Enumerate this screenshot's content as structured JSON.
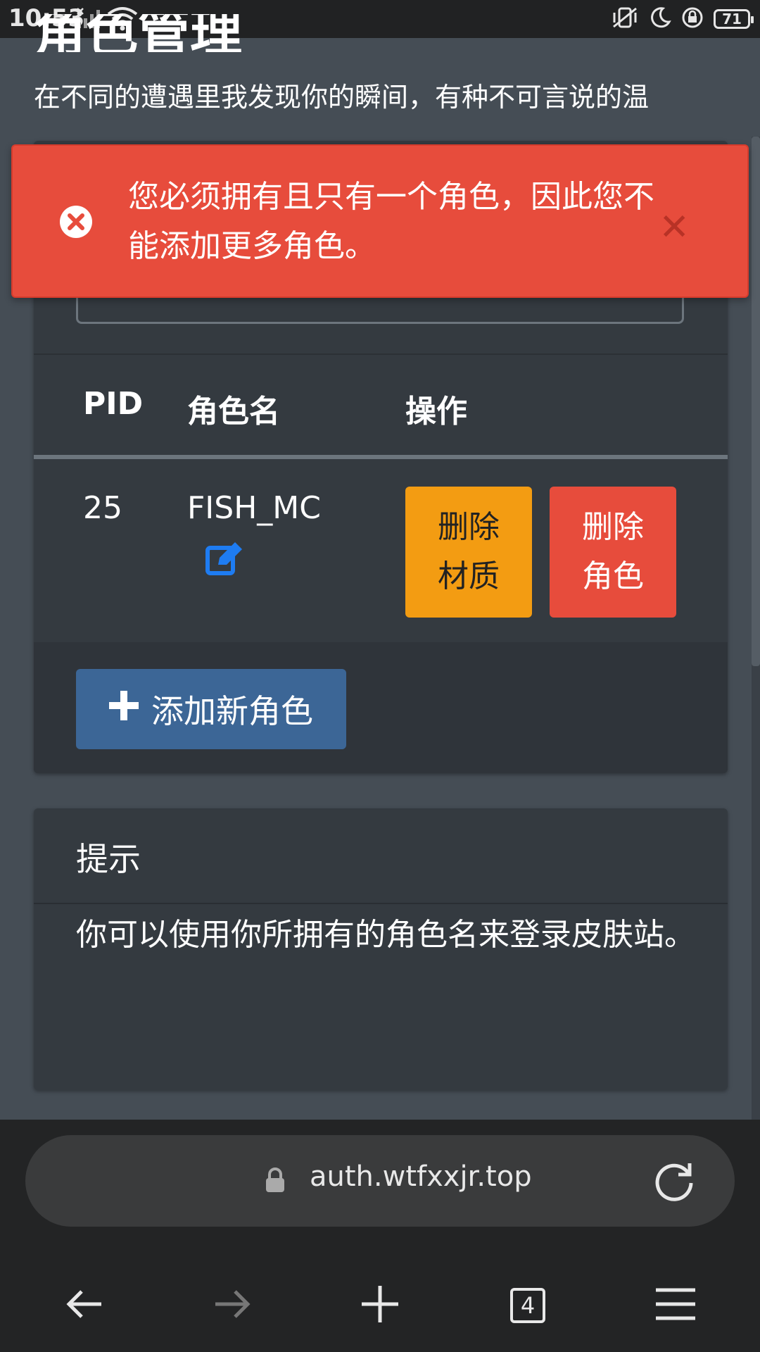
{
  "status_bar": {
    "time": "10:53",
    "battery": "71"
  },
  "page": {
    "title": "角色管理",
    "subtitle": "在不同的遭遇里我发现你的瞬间，有种不可言说的温"
  },
  "alert": {
    "message": "您必须拥有且只有一个角色，因此您不能添加更多角色。",
    "icon": "error-circle-icon",
    "close_icon": "close-icon"
  },
  "players_table": {
    "columns": [
      "PID",
      "角色名",
      "操作"
    ],
    "rows": [
      {
        "pid": "25",
        "name": "FISH_MC",
        "actions": {
          "delete_texture": "删除材质",
          "delete_player": "删除角色"
        }
      }
    ],
    "add_button": "添加新角色"
  },
  "tips": {
    "title": "提示",
    "body": "你可以使用你所拥有的角色名来登录皮肤站。"
  },
  "browser": {
    "url": "auth.wtfxxjr.top",
    "tab_count": "4"
  },
  "colors": {
    "page_bg": "#454d55",
    "card_bg": "#343a40",
    "danger": "#e74c3c",
    "warning": "#f39c12",
    "primary": "#3c6696",
    "link_blue": "#1e7cf2"
  }
}
